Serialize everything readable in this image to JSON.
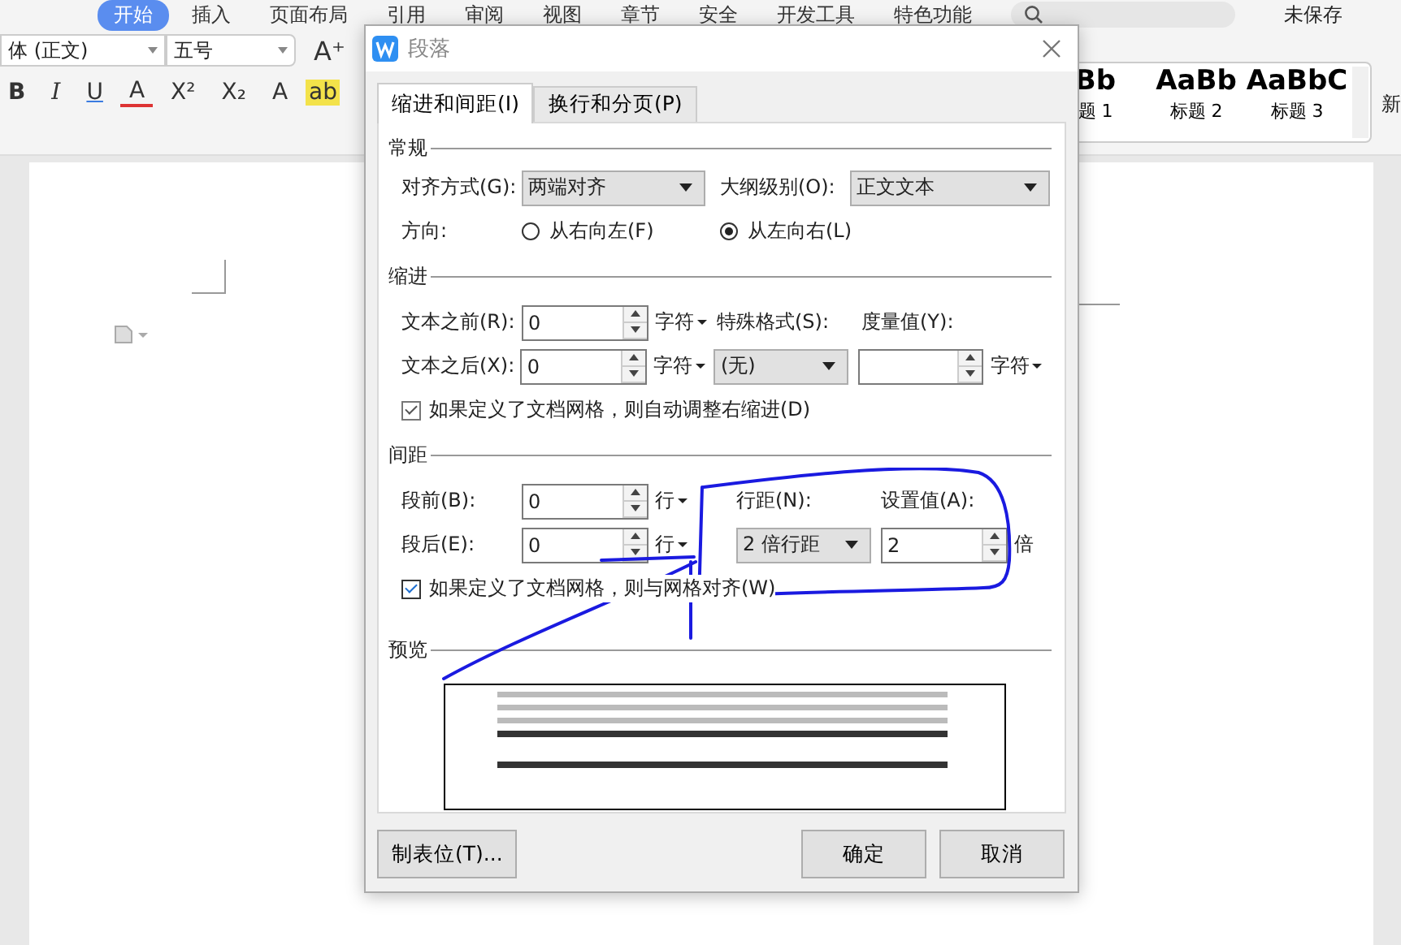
{
  "ribbon": {
    "tabs": [
      {
        "label": "开始",
        "selected": true
      },
      {
        "label": "插入",
        "selected": false
      },
      {
        "label": "页面布局",
        "selected": false
      },
      {
        "label": "引用",
        "selected": false
      },
      {
        "label": "审阅",
        "selected": false
      },
      {
        "label": "视图",
        "selected": false
      },
      {
        "label": "章节",
        "selected": false
      },
      {
        "label": "安全",
        "selected": false
      },
      {
        "label": "开发工具",
        "selected": false
      },
      {
        "label": "特色功能",
        "selected": false
      }
    ],
    "save_status": "未保存",
    "font_name": "体 (正文)",
    "font_size": "五号",
    "size_glyphs": [
      "A⁺"
    ],
    "format_glyphs": [
      "B",
      "I",
      "U",
      "A",
      "X²",
      "X₂",
      "A",
      "ab"
    ],
    "styles": [
      {
        "preview": "Bb",
        "label": "题 1"
      },
      {
        "preview": "AaBb",
        "label": "标题 2"
      },
      {
        "preview": "AaBbC",
        "label": "标题 3"
      }
    ],
    "new_style": "新"
  },
  "dialog": {
    "title": "段落",
    "tabs": [
      {
        "label": "缩进和间距(I)",
        "selected": true
      },
      {
        "label": "换行和分页(P)",
        "selected": false
      }
    ],
    "general": {
      "heading": "常规",
      "alignment": {
        "label": "对齐方式(G):",
        "value": "两端对齐"
      },
      "outline_level": {
        "label": "大纲级别(O):",
        "value": "正文文本"
      },
      "direction": {
        "label": "方向:",
        "options": [
          {
            "label": "从右向左(F)",
            "selected": false
          },
          {
            "label": "从左向右(L)",
            "selected": true
          }
        ]
      }
    },
    "indent": {
      "heading": "缩进",
      "before": {
        "label": "文本之前(R):",
        "value": "0",
        "unit": "字符"
      },
      "after": {
        "label": "文本之后(X):",
        "value": "0",
        "unit": "字符"
      },
      "special": {
        "label": "特殊格式(S):",
        "value": "(无)"
      },
      "measure": {
        "label": "度量值(Y):",
        "unit": "字符"
      },
      "auto_adjust": {
        "label": "如果定义了文档网格，则自动调整右缩进(D)",
        "checked": true
      }
    },
    "spacing": {
      "heading": "间距",
      "before": {
        "label": "段前(B):",
        "value": "0",
        "unit": "行"
      },
      "after": {
        "label": "段后(E):",
        "value": "0",
        "unit": "行"
      },
      "line_spacing": {
        "label": "行距(N):",
        "value": "2 倍行距"
      },
      "set_value": {
        "label": "设置值(A):",
        "value": "2",
        "unit": "倍"
      },
      "snap_to_grid": {
        "label": "如果定义了文档网格，则与网格对齐(W)",
        "checked": true
      }
    },
    "preview": {
      "heading": "预览"
    },
    "buttons": {
      "tab_stops": "制表位(T)...",
      "ok": "确定",
      "cancel": "取消"
    }
  }
}
